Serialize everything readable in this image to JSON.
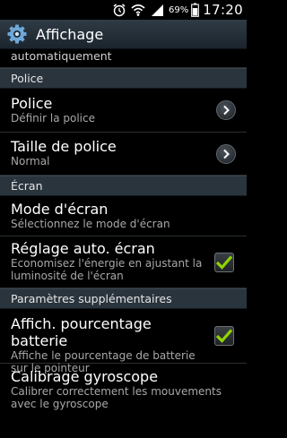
{
  "status_bar": {
    "battery_percent": "69%",
    "time": "17:20",
    "icons": [
      "alarm-icon",
      "wifi-icon",
      "signal-icon",
      "battery-icon"
    ]
  },
  "action_bar": {
    "title": "Affichage",
    "icon": "settings-gear-icon"
  },
  "list": {
    "truncated_text": "automatiquement",
    "sections": [
      {
        "header": "Police",
        "items": [
          {
            "title": "Police",
            "subtitle": "Définir la police",
            "control": "chevron"
          },
          {
            "title": "Taille de police",
            "subtitle": "Normal",
            "control": "chevron"
          }
        ]
      },
      {
        "header": "Écran",
        "items": [
          {
            "title": "Mode d'écran",
            "subtitle": "Sélectionnez le mode d'écran",
            "control": "none"
          },
          {
            "title": "Réglage auto. écran",
            "subtitle": "Economisez l'énergie en ajustant la luminosité de l'écran",
            "control": "checkbox",
            "checked": true
          }
        ]
      },
      {
        "header": "Paramètres supplémentaires",
        "items": [
          {
            "title": "Affich. pourcentage batterie",
            "subtitle": "Affiche le pourcentage de batterie sur le pointeur",
            "control": "checkbox",
            "checked": true
          },
          {
            "title": "Calibrage gyroscope",
            "subtitle": "Calibrer correctement les mouvements avec le gyroscope",
            "control": "none"
          }
        ]
      }
    ]
  },
  "colors": {
    "checkmark": "#8fd400",
    "section_header_bg": "#2a343d",
    "action_bar_bg": "#2f3b45"
  }
}
